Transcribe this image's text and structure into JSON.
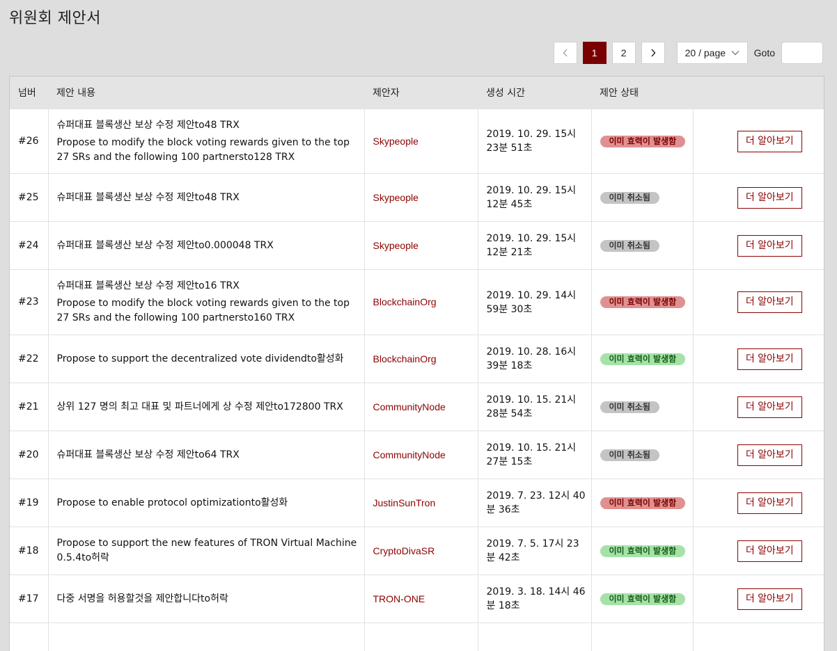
{
  "page": {
    "title": "위원회 제안서"
  },
  "pagination": {
    "pages": [
      "1",
      "2"
    ],
    "active_page": "1",
    "page_size": "20 / page",
    "goto_label": "Goto",
    "goto_value": ""
  },
  "colors": {
    "accent": "#7a0000",
    "link": "#8b0000",
    "badge_active": "#e09090",
    "badge_cancelled": "#c4c4c4",
    "badge_approved": "#a6e2a8"
  },
  "table": {
    "headers": [
      "넘버",
      "제안 내용",
      "제안자",
      "생성 시간",
      "제안 상태"
    ],
    "rows": [
      {
        "num": "#26",
        "content": [
          "슈퍼대표 블록생산 보상 수정 제안to48  TRX",
          "Propose to modify the block voting rewards given to the top 27 SRs and the following 100 partnersto128  TRX"
        ],
        "proposer": "Skypeople",
        "time": "2019. 10. 29. 15시 23분 51초",
        "status": "이미 효력이 발생함",
        "status_type": "red",
        "action": "더 알아보기",
        "height": 93
      },
      {
        "num": "#25",
        "content": [
          "슈퍼대표 블록생산 보상 수정 제안to48  TRX"
        ],
        "proposer": "Skypeople",
        "time": "2019. 10. 29. 15시 12분 45초",
        "status": "이미 취소됨",
        "status_type": "gray",
        "action": "더 알아보기",
        "height": 69
      },
      {
        "num": "#24",
        "content": [
          "슈퍼대표 블록생산 보상 수정 제안to0.000048  TRX"
        ],
        "proposer": "Skypeople",
        "time": "2019. 10. 29. 15시 12분 21초",
        "status": "이미 취소됨",
        "status_type": "gray",
        "action": "더 알아보기",
        "height": 69
      },
      {
        "num": "#23",
        "content": [
          "슈퍼대표 블록생산 보상 수정 제안to16  TRX",
          "Propose to modify the block voting rewards given to the top 27 SRs and the following 100 partnersto160  TRX"
        ],
        "proposer": "BlockchainOrg",
        "time": "2019. 10. 29. 14시 59분 30초",
        "status": "이미 효력이 발생함",
        "status_type": "red",
        "action": "더 알아보기",
        "height": 94
      },
      {
        "num": "#22",
        "content": [
          "Propose to support the decentralized vote dividendto활성화"
        ],
        "proposer": "BlockchainOrg",
        "time": "2019. 10. 28. 16시 39분 18초",
        "status": "이미 효력이 발생함",
        "status_type": "green",
        "action": "더 알아보기",
        "height": 69
      },
      {
        "num": "#21",
        "content": [
          "상위 127 명의 최고 대표 및 파트너에게 상 수정 제안to172800  TRX"
        ],
        "proposer": "CommunityNode",
        "time": "2019. 10. 15. 21시 28분 54초",
        "status": "이미 취소됨",
        "status_type": "gray",
        "action": "더 알아보기",
        "height": 69
      },
      {
        "num": "#20",
        "content": [
          "슈퍼대표 블록생산 보상 수정 제안to64  TRX"
        ],
        "proposer": "CommunityNode",
        "time": "2019. 10. 15. 21시 27분 15초",
        "status": "이미 취소됨",
        "status_type": "gray",
        "action": "더 알아보기",
        "height": 69
      },
      {
        "num": "#19",
        "content": [
          "Propose to enable protocol optimizationto활성화"
        ],
        "proposer": "JustinSunTron",
        "time": "2019. 7. 23. 12시 40분 36초",
        "status": "이미 효력이 발생함",
        "status_type": "red",
        "action": "더 알아보기",
        "height": 69
      },
      {
        "num": "#18",
        "content": [
          "Propose to support the new features of TRON Virtual Machine 0.5.4to허락"
        ],
        "proposer": "CryptoDivaSR",
        "time": "2019. 7. 5. 17시 23분 42초",
        "status": "이미 효력이 발생함",
        "status_type": "green",
        "action": "더 알아보기",
        "height": 69
      },
      {
        "num": "#17",
        "content": [
          "다중 서명을 허용할것을 제안합니다to허락"
        ],
        "proposer": "TRON-ONE",
        "time": "2019. 3. 18. 14시 46분 18초",
        "status": "이미 효력이 발생함",
        "status_type": "green",
        "action": "더 알아보기",
        "height": 69
      },
      {
        "num": "",
        "content": [
          ""
        ],
        "proposer": "",
        "time": "",
        "status": "",
        "status_type": "",
        "action": "",
        "height": 40
      }
    ]
  }
}
